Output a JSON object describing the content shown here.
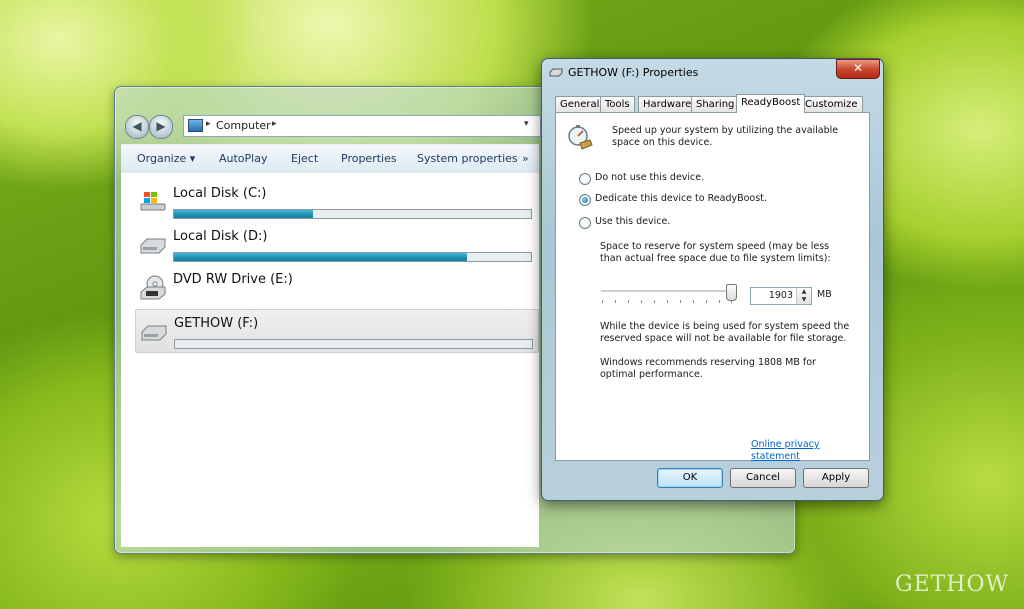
{
  "explorer": {
    "address": "Computer",
    "toolbar": {
      "organize": "Organize ▾",
      "autoplay": "AutoPlay",
      "eject": "Eject",
      "properties": "Properties",
      "system_properties": "System properties",
      "more": "»"
    },
    "drives": [
      {
        "name": "Local Disk (C:)",
        "icon": "windows-drive-icon",
        "used_fraction": 0.39
      },
      {
        "name": "Local Disk (D:)",
        "icon": "hard-drive-icon",
        "used_fraction": 0.82
      },
      {
        "name": "DVD RW Drive (E:)",
        "icon": "dvd-drive-icon"
      },
      {
        "name": "GETHOW (F:)",
        "icon": "usb-drive-icon",
        "used_fraction": 0.0,
        "selected": true
      }
    ]
  },
  "dialog": {
    "title": "GETHOW (F:) Properties",
    "close": "✕",
    "tabs": [
      "General",
      "Tools",
      "Hardware",
      "Sharing",
      "ReadyBoost",
      "Customize"
    ],
    "active_tab": "ReadyBoost",
    "intro": "Speed up your system by utilizing the available space on this device.",
    "options": [
      {
        "label": "Do not use this device.",
        "selected": false
      },
      {
        "label": "Dedicate this device to ReadyBoost.",
        "selected": true
      },
      {
        "label": "Use this device.",
        "selected": false
      }
    ],
    "reserve_label": "Space to reserve for system speed (may be less than actual free space due to file system limits):",
    "reserve_value": "1903",
    "reserve_unit": "MB",
    "warning": "While the device is being used for system speed the reserved space will not be available for file storage.",
    "recommendation": "Windows recommends reserving 1808 MB for optimal performance.",
    "privacy_link": "Online privacy statement",
    "buttons": {
      "ok": "OK",
      "cancel": "Cancel",
      "apply": "Apply"
    }
  },
  "watermark": "GETHOW",
  "colors": {
    "accent": "#1d8fb3",
    "link": "#0066cc"
  }
}
